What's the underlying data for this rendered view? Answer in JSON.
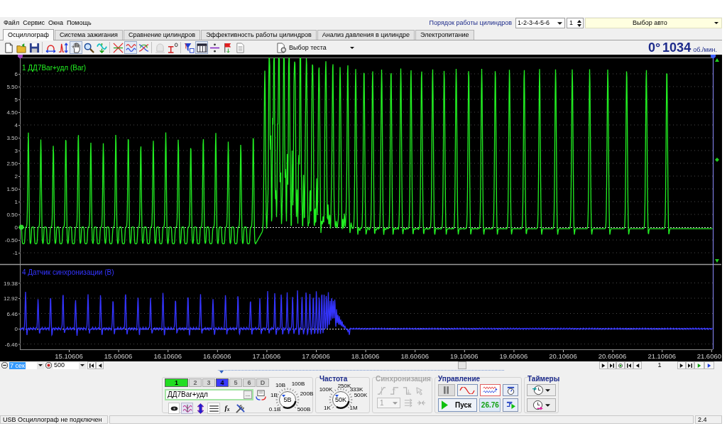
{
  "menu": [
    "Файл",
    "Сервис",
    "Окна",
    "Помощь"
  ],
  "cylinder_order": {
    "label": "Порядок работы цилиндров",
    "value": "1-2-3-4-5-6",
    "cylinder": "1"
  },
  "car_select": {
    "value": "Выбор авто"
  },
  "tabs": [
    {
      "label": "Осциллограф",
      "selected": true
    },
    {
      "label": "Система зажигания",
      "selected": false
    },
    {
      "label": "Сравнение цилиндров",
      "selected": false
    },
    {
      "label": "Эффективность работы цилиндров",
      "selected": false
    },
    {
      "label": "Анализ давления в цилиндре",
      "selected": false
    },
    {
      "label": "Электропитание",
      "selected": false
    }
  ],
  "toolbar": [
    {
      "kind": "new",
      "pressed": false,
      "disabled": false
    },
    {
      "kind": "open",
      "pressed": false,
      "disabled": false
    },
    {
      "kind": "save",
      "pressed": false,
      "disabled": false
    },
    {
      "kind": "arc",
      "pressed": false,
      "disabled": false
    },
    {
      "kind": "pulse",
      "pressed": false,
      "disabled": false
    },
    {
      "kind": "hand",
      "pressed": true,
      "disabled": false
    },
    {
      "kind": "zoom",
      "pressed": false,
      "disabled": false
    },
    {
      "kind": "fit",
      "pressed": false,
      "disabled": false
    },
    {
      "kind": "cross",
      "pressed": false,
      "disabled": false
    },
    {
      "kind": "overlay",
      "pressed": true,
      "disabled": false
    },
    {
      "kind": "loop",
      "pressed": false,
      "disabled": false
    },
    {
      "kind": "bell",
      "pressed": false,
      "disabled": true
    },
    {
      "kind": "zero",
      "pressed": false,
      "disabled": false
    },
    {
      "kind": "filter",
      "pressed": false,
      "disabled": false
    },
    {
      "kind": "table",
      "pressed": true,
      "disabled": false
    },
    {
      "kind": "divide",
      "pressed": false,
      "disabled": false
    },
    {
      "kind": "flag",
      "pressed": false,
      "disabled": false
    },
    {
      "kind": "page",
      "pressed": false,
      "disabled": false
    }
  ],
  "test_select": {
    "value": "Выбор теста"
  },
  "rpm": {
    "angle": "0°",
    "value": "1034",
    "unit": "об./мин."
  },
  "scope": {
    "panels": [
      {
        "title": "1 ДД7Bar+удл (Bar)",
        "color": "#22ee22",
        "y_ticks": [
          "6",
          "5.50",
          "5",
          "4.50",
          "4",
          "3.50",
          "3",
          "2.50",
          "2",
          "1.50",
          "1",
          "0.50",
          "0",
          "-0.50",
          "-1"
        ]
      },
      {
        "title": "4 Датчик синхронизации (В)",
        "color": "#3434ff",
        "y_ticks": [
          "19.38",
          "12.92",
          "6.46",
          "0",
          "-6.46"
        ]
      }
    ],
    "x_ticks": [
      "15.10606",
      "15.60606",
      "16.10606",
      "16.60606",
      "17.10606",
      "17.60606",
      "18.10606",
      "18.60606",
      "19.10606",
      "19.60606",
      "20.10606",
      "20.60606",
      "21.10606",
      "21.6060"
    ]
  },
  "navigation": {
    "timebase": "7 сек",
    "samples": "500",
    "page": "1"
  },
  "channels": {
    "buttons": [
      {
        "label": "1",
        "on": true,
        "color": "#22dd22"
      },
      {
        "label": "2",
        "on": false
      },
      {
        "label": "3",
        "on": false
      },
      {
        "label": "4",
        "on": true,
        "color": "#3a3aff"
      },
      {
        "label": "5",
        "on": false
      },
      {
        "label": "6",
        "on": false
      },
      {
        "label": "D",
        "on": false
      }
    ],
    "sensor": "ДД7Bar+удл",
    "browse": "...",
    "formula": "f$_{x}$",
    "range_knob": {
      "value": "5B",
      "scale": [
        "10B",
        "100B",
        "1B",
        "200B",
        "0.1B",
        "500B"
      ]
    }
  },
  "frequency": {
    "title": "Частота",
    "knob": {
      "value": "50K",
      "scale": [
        "250K",
        "100K",
        "333K",
        "500K",
        "1K",
        "1M"
      ]
    }
  },
  "sync": {
    "title": "Синхронизация",
    "disabled": true,
    "channel": "1"
  },
  "control": {
    "title": "Управление",
    "start": "Пуск",
    "reading": "26.76"
  },
  "timers": {
    "title": "Таймеры"
  },
  "status_bar": {
    "message": "USB Осциллограф не подключен",
    "version": "2.4"
  }
}
